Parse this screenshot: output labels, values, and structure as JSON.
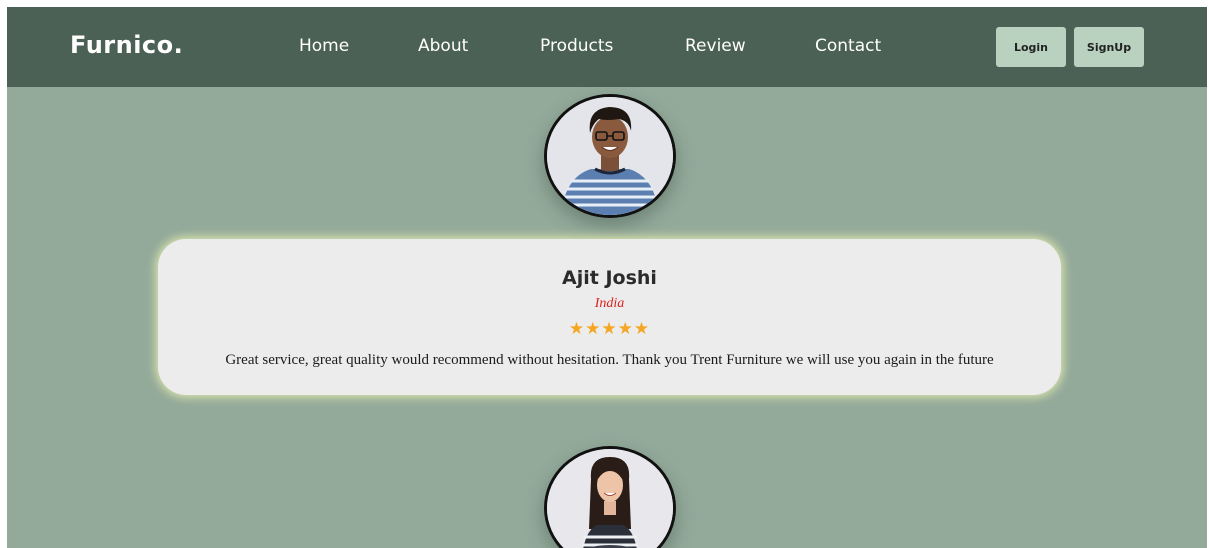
{
  "brand": {
    "logo_text": "Furnico."
  },
  "nav": {
    "links": [
      {
        "label": "Home"
      },
      {
        "label": "About"
      },
      {
        "label": "Products"
      },
      {
        "label": "Review"
      },
      {
        "label": "Contact"
      }
    ],
    "login_label": "Login",
    "signup_label": "SignUp"
  },
  "reviews": [
    {
      "name": "Ajit Joshi",
      "country": "India",
      "rating": 5,
      "stars": "★★★★★",
      "text": "Great service, great quality would recommend without hesitation. Thank you Trent Furniture we will use you again in the future"
    }
  ],
  "colors": {
    "navbar": "#4b6155",
    "page_background": "#93a99a",
    "button": "#b9d2bf",
    "card": "#ececec",
    "country": "#d9231f",
    "star": "#f5a623"
  },
  "icons": {
    "star": "star-icon"
  }
}
